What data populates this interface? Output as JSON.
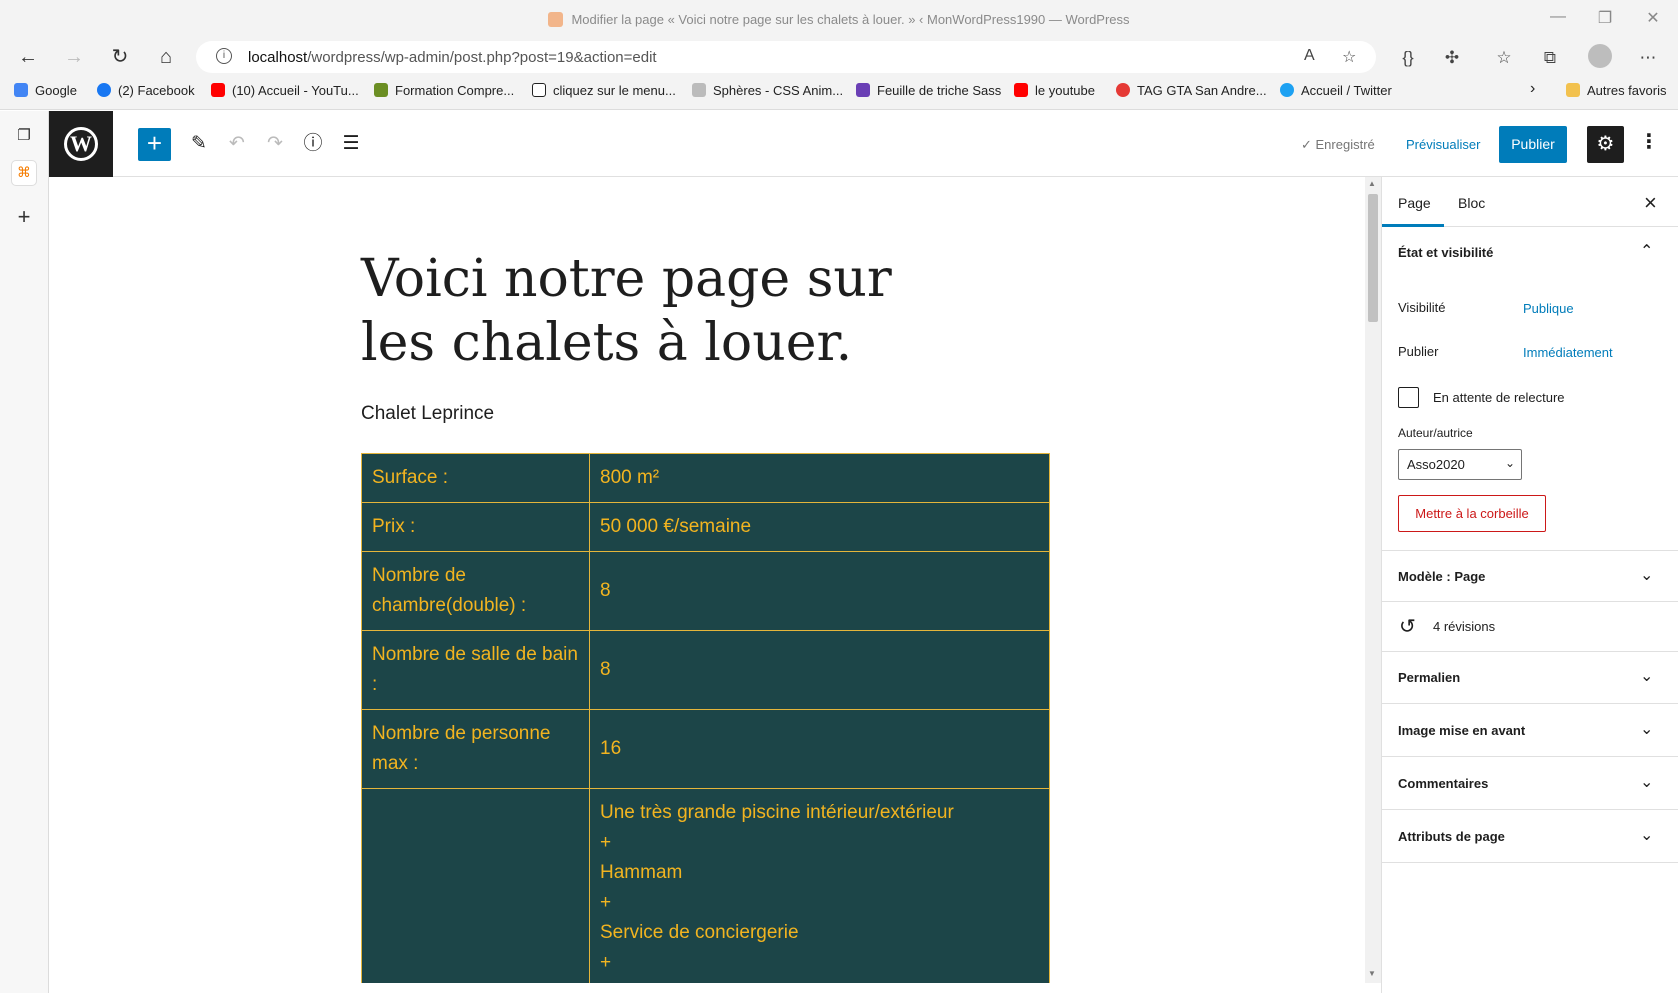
{
  "browser": {
    "window_title": "Modifier la page « Voici notre page sur les chalets à louer. » ‹ MonWordPress1990 — WordPress",
    "url_host": "localhost",
    "url_path": "/wordpress/wp-admin/post.php?post=19&action=edit",
    "bookmarks": [
      {
        "label": "Google",
        "color": "#4285f4"
      },
      {
        "label": "(2) Facebook",
        "color": "#1877f2"
      },
      {
        "label": "(10) Accueil - YouTu...",
        "color": "#ff0000"
      },
      {
        "label": "Formation Compre...",
        "color": "#6b8e23"
      },
      {
        "label": "cliquez sur le menu...",
        "color": "#222222"
      },
      {
        "label": "Sphères - CSS Anim...",
        "color": "#999999"
      },
      {
        "label": "Feuille de triche Sass",
        "color": "#6a3fb5"
      },
      {
        "label": "le youtube",
        "color": "#ff0000"
      },
      {
        "label": "TAG GTA San Andre...",
        "color": "#e53935"
      },
      {
        "label": "Accueil / Twitter",
        "color": "#1da1f2"
      }
    ],
    "other_favorites": "Autres favoris"
  },
  "editor": {
    "header": {
      "saved_label": "✓ Enregistré",
      "preview_label": "Prévisualiser",
      "publish_label": "Publier"
    },
    "post_title": "Voici notre page sur les chalets à louer.",
    "subtitle": "Chalet Leprince",
    "table": {
      "rows": [
        {
          "label": "Surface :",
          "value": "800 m²"
        },
        {
          "label": "Prix :",
          "value": "50 000 €/semaine"
        },
        {
          "label": "Nombre de chambre(double) :",
          "value": "8"
        },
        {
          "label": "Nombre de salle de bain :",
          "value": "8"
        },
        {
          "label": "Nombre de personne max :",
          "value": "16"
        }
      ],
      "extras": [
        "Une très grande piscine intérieur/extérieur",
        "+",
        "Hammam",
        "+",
        "Service de conciergerie",
        "+"
      ]
    }
  },
  "sidebar": {
    "tab_page": "Page",
    "tab_block": "Bloc",
    "status_section": "État et visibilité",
    "visibility_label": "Visibilité",
    "visibility_value": "Publique",
    "publish_label": "Publier",
    "publish_value": "Immédiatement",
    "pending_review_label": "En attente de relecture",
    "author_label": "Auteur/autrice",
    "author_value": "Asso2020",
    "trash_label": "Mettre à la corbeille",
    "template_section": "Modèle : Page",
    "revisions_label": "4 révisions",
    "permalink_section": "Permalien",
    "featured_image_section": "Image mise en avant",
    "comments_section": "Commentaires",
    "page_attributes_section": "Attributs de page"
  }
}
